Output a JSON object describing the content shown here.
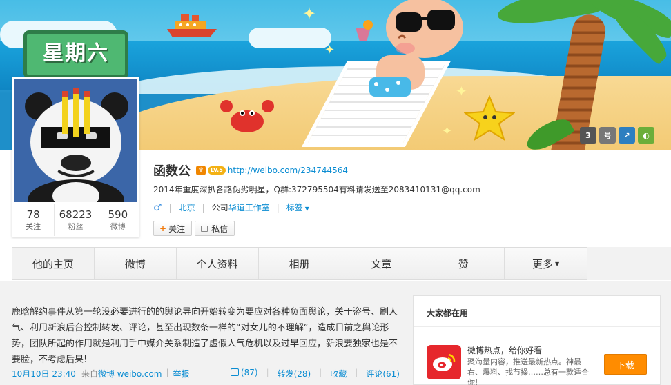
{
  "cover": {
    "day_sign": "星期六",
    "icons": [
      {
        "name": "vip-level-icon",
        "text": "3",
        "color": "#555555"
      },
      {
        "name": "account-number-icon",
        "text": "号",
        "color": "#777777"
      },
      {
        "name": "share-icon",
        "text": "↗",
        "color": "#2d7fc0"
      },
      {
        "name": "theme-icon",
        "text": "◐",
        "color": "#6cae3a"
      }
    ]
  },
  "profile": {
    "name": "函数公",
    "level_badge": "LV.5",
    "url": "http://weibo.com/234744564",
    "bio": "2014年重度深扒各路伪劣明星，Q群:372795504有料请发送至2083410131@qq.com",
    "gender_symbol": "♂",
    "location": "北京",
    "company_label": "公司",
    "company_name": "华谊工作室",
    "tags_label": "标签",
    "follow_button": "关注",
    "message_button": "私信"
  },
  "stats": [
    {
      "num": "78",
      "label": "关注"
    },
    {
      "num": "68223",
      "label": "粉丝"
    },
    {
      "num": "590",
      "label": "微博"
    }
  ],
  "tabs": [
    {
      "label": "他的主页"
    },
    {
      "label": "微博"
    },
    {
      "label": "个人资料"
    },
    {
      "label": "相册"
    },
    {
      "label": "文章"
    },
    {
      "label": "赞"
    },
    {
      "label": "更多"
    }
  ],
  "post": {
    "text": "鹿晗解约事件从第一轮没必要进行的的舆论导向开始转变为要应对各种负面舆论，关于盗号、刷人气、利用新浪后台控制转发、评论，甚至出现数条一样的“对女儿的不理解”，造成目前之舆论形势，团队所起的作用就是利用手中媒介关系制造了虚假人气危机以及过早回应，新浪要独家也是不要脸，不考虑后果!",
    "time": "10月10日 23:40",
    "source_prefix": "来自",
    "source_link": "微博 weibo.com",
    "report": "举报",
    "like": "(87)",
    "forward": "转发(28)",
    "favorite": "收藏",
    "comment": "评论(61)"
  },
  "side": {
    "title": "大家都在用",
    "app_name": "微博热点，给你好看",
    "app_desc": "聚海量内容，推送最新热点。神最右、爆料、找节操……总有一款适合你!",
    "download": "下载"
  },
  "colors": {
    "link": "#0a8cd2",
    "download": "#ff8c00",
    "app_icon": "#e6272c"
  }
}
